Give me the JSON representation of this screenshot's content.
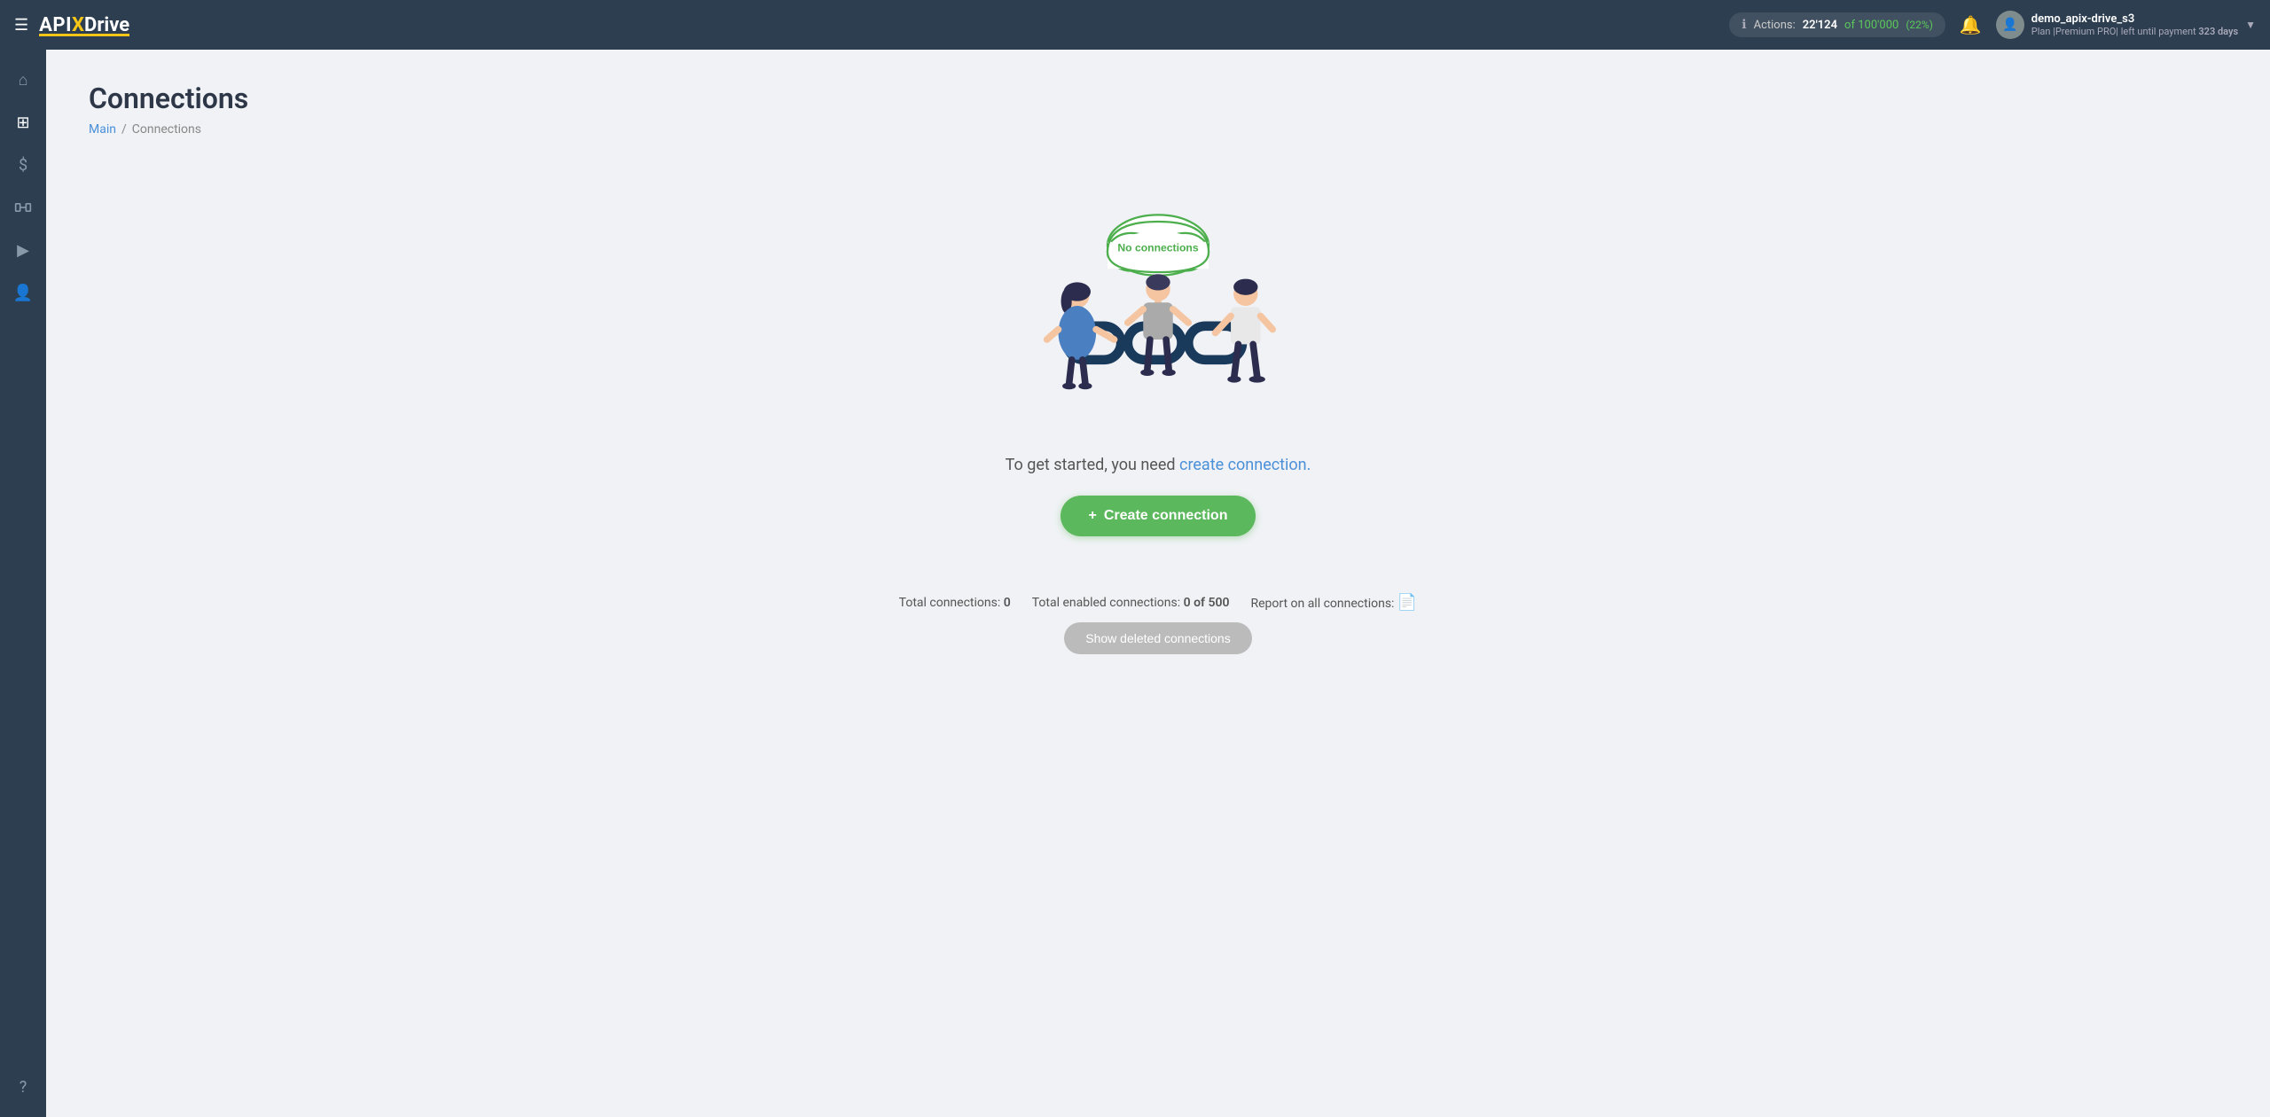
{
  "navbar": {
    "menu_icon": "☰",
    "logo_api": "API",
    "logo_x": "X",
    "logo_drive": "Drive",
    "actions_label": "Actions:",
    "actions_used": "22'124",
    "actions_total": "100'000",
    "actions_pct": "(22%)",
    "bell_icon": "🔔",
    "user_name": "demo_apix-drive_s3",
    "user_plan": "Plan |Premium PRO| left until payment",
    "user_days": "323 days",
    "chevron": "▼"
  },
  "sidebar": {
    "items": [
      {
        "icon": "⌂",
        "label": "home-icon"
      },
      {
        "icon": "⊞",
        "label": "connections-icon"
      },
      {
        "icon": "$",
        "label": "billing-icon"
      },
      {
        "icon": "💼",
        "label": "integrations-icon"
      },
      {
        "icon": "▶",
        "label": "video-icon"
      },
      {
        "icon": "👤",
        "label": "profile-icon"
      },
      {
        "icon": "?",
        "label": "help-icon"
      }
    ]
  },
  "page": {
    "title": "Connections",
    "breadcrumb_main": "Main",
    "breadcrumb_sep": "/",
    "breadcrumb_current": "Connections"
  },
  "empty_state": {
    "cloud_text": "No connections",
    "cta_prefix": "To get started, you need ",
    "cta_link": "create connection.",
    "cta_suffix": ""
  },
  "create_button": {
    "plus": "+",
    "label": "Create connection"
  },
  "stats": {
    "total_label": "Total connections:",
    "total_value": "0",
    "enabled_label": "Total enabled connections:",
    "enabled_value": "0 of 500",
    "report_label": "Report on all connections:",
    "report_icon": "📄"
  },
  "show_deleted": {
    "label": "Show deleted connections"
  }
}
